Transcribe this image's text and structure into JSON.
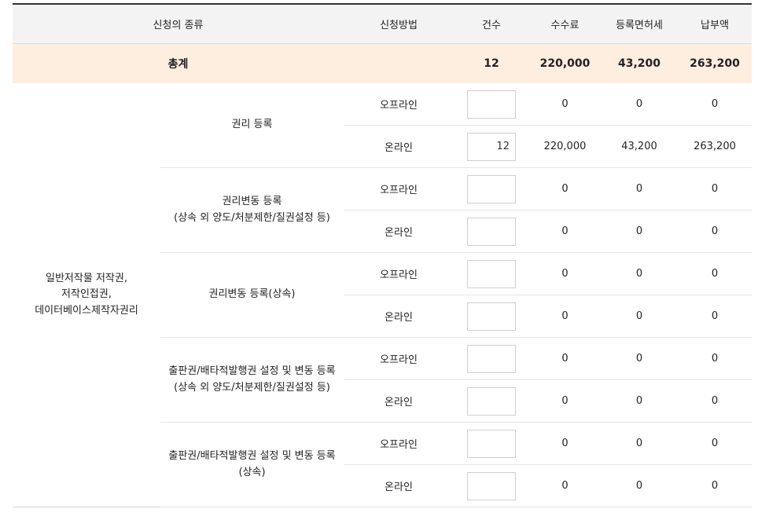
{
  "headers": {
    "type": "신청의 종류",
    "method": "신청방법",
    "count": "건수",
    "fee": "수수료",
    "tax": "등록면허세",
    "total": "납부액"
  },
  "total_row": {
    "label": "총계",
    "count": "12",
    "fee": "220,000",
    "tax": "43,200",
    "total": "263,200"
  },
  "category": {
    "line1": "일반저작물 저작권,",
    "line2": "저작인접권,",
    "line3": "데이터베이스제작자권리"
  },
  "groups": [
    {
      "type_line1": "권리 등록",
      "type_line2": "",
      "rows": [
        {
          "method": "오프라인",
          "count": "",
          "fee": "0",
          "tax": "0",
          "total": "0"
        },
        {
          "method": "온라인",
          "count": "12",
          "fee": "220,000",
          "tax": "43,200",
          "total": "263,200"
        }
      ]
    },
    {
      "type_line1": "권리변동 등록",
      "type_line2": "(상속 외 양도/처분제한/질권설정 등)",
      "rows": [
        {
          "method": "오프라인",
          "count": "",
          "fee": "0",
          "tax": "0",
          "total": "0"
        },
        {
          "method": "온라인",
          "count": "",
          "fee": "0",
          "tax": "0",
          "total": "0"
        }
      ]
    },
    {
      "type_line1": "권리변동 등록(상속)",
      "type_line2": "",
      "rows": [
        {
          "method": "오프라인",
          "count": "",
          "fee": "0",
          "tax": "0",
          "total": "0"
        },
        {
          "method": "온라인",
          "count": "",
          "fee": "0",
          "tax": "0",
          "total": "0"
        }
      ]
    },
    {
      "type_line1": "출판권/배타적발행권 설정 및 변동 등록",
      "type_line2": "(상속 외 양도/처분제한/질권설정 등)",
      "rows": [
        {
          "method": "오프라인",
          "count": "",
          "fee": "0",
          "tax": "0",
          "total": "0"
        },
        {
          "method": "온라인",
          "count": "",
          "fee": "0",
          "tax": "0",
          "total": "0"
        }
      ]
    },
    {
      "type_line1": "출판권/배타적발행권 설정 및 변동 등록",
      "type_line2": "(상속)",
      "rows": [
        {
          "method": "오프라인",
          "count": "",
          "fee": "0",
          "tax": "0",
          "total": "0"
        },
        {
          "method": "온라인",
          "count": "",
          "fee": "0",
          "tax": "0",
          "total": "0"
        }
      ]
    }
  ]
}
